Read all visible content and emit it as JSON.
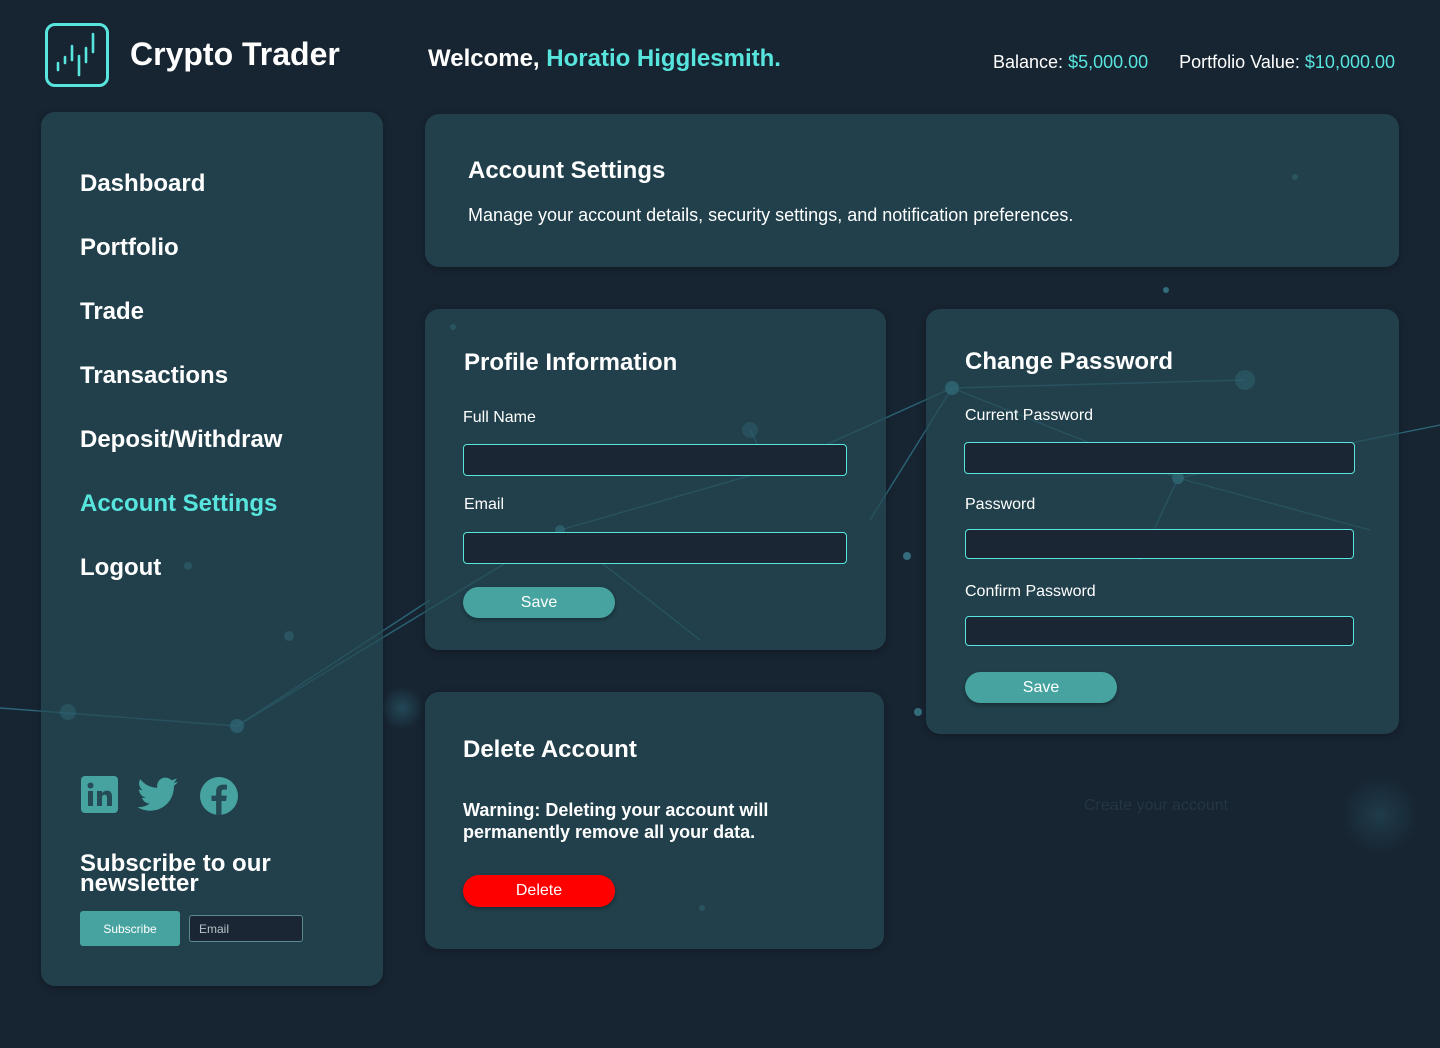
{
  "header": {
    "brand": "Crypto Trader",
    "welcome_prefix": "Welcome, ",
    "user_name": "Horatio Higglesmith.",
    "balance_label": "Balance: ",
    "balance_value": "$5,000.00",
    "portfolio_label": "Portfolio Value: ",
    "portfolio_value": "$10,000.00"
  },
  "sidebar": {
    "items": [
      {
        "label": "Dashboard",
        "active": false
      },
      {
        "label": "Portfolio",
        "active": false
      },
      {
        "label": "Trade",
        "active": false
      },
      {
        "label": "Transactions",
        "active": false
      },
      {
        "label": "Deposit/Withdraw",
        "active": false
      },
      {
        "label": "Account Settings",
        "active": true
      },
      {
        "label": "Logout",
        "active": false
      }
    ],
    "socials": [
      "linkedin-icon",
      "twitter-icon",
      "facebook-icon"
    ],
    "newsletter": {
      "title": "Subscribe to our newsletter",
      "button": "Subscribe",
      "placeholder": "Email"
    }
  },
  "intro": {
    "title": "Account Settings",
    "description": "Manage your account details, security settings, and notification preferences."
  },
  "profile": {
    "title": "Profile Information",
    "full_name_label": "Full Name",
    "full_name_value": "",
    "email_label": "Email",
    "email_value": "",
    "save": "Save"
  },
  "password": {
    "title": "Change Password",
    "current_label": "Current Password",
    "new_label": "Password",
    "confirm_label": "Confirm Password",
    "save": "Save"
  },
  "delete_account": {
    "title": "Delete Account",
    "warning": "Warning: Deleting your account will permanently remove all your data.",
    "button": "Delete"
  },
  "background_text": "Create your account",
  "colors": {
    "accent": "#57e5de",
    "background": "#172431",
    "card": "#254b56",
    "button": "#47a3a0",
    "danger": "#ff0000"
  }
}
